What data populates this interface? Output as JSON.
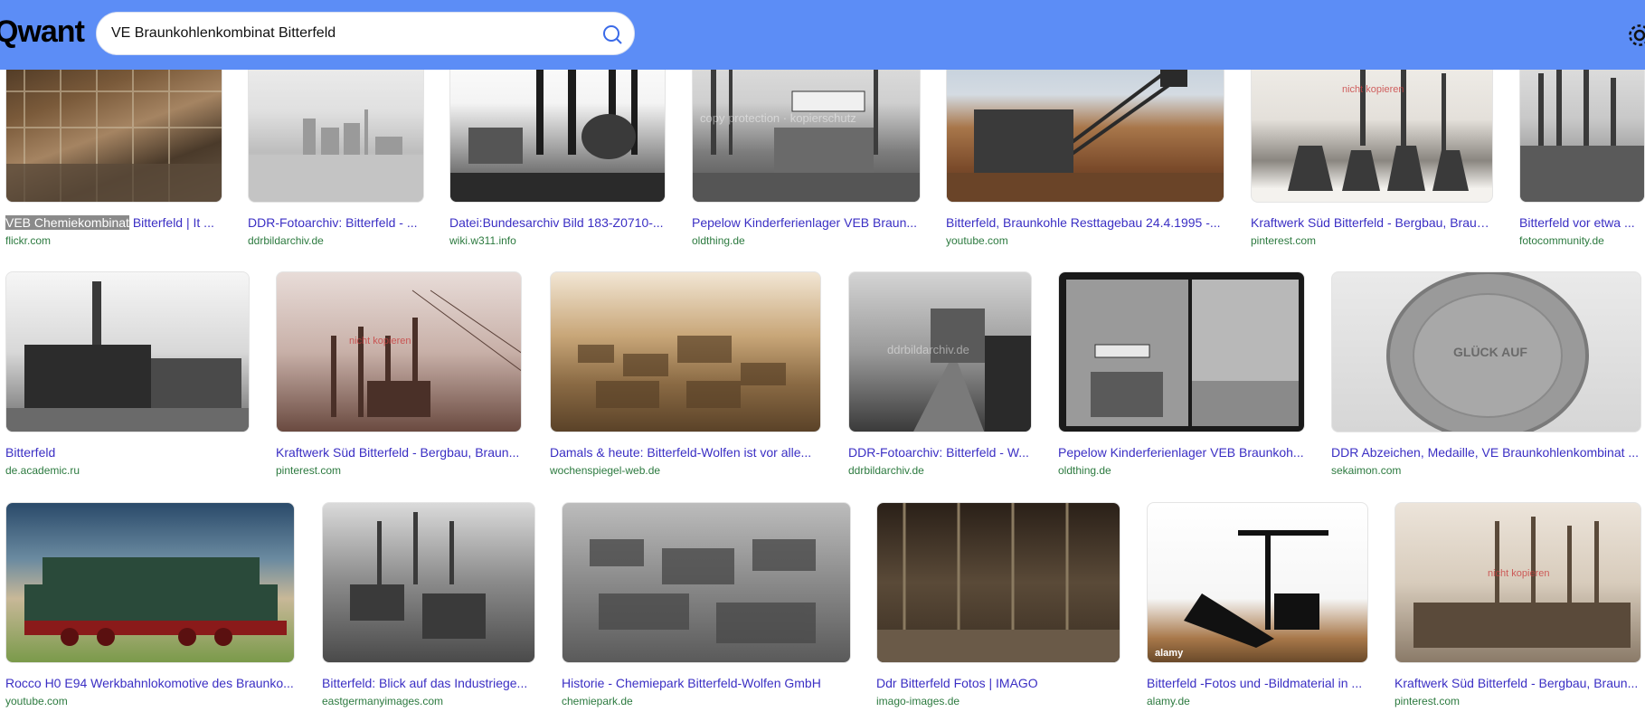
{
  "header": {
    "logo": "Qwant",
    "search_value": "VE Braunkohlenkombinat Bitterfeld",
    "search_icon": "search-icon",
    "settings_icon": "gear-icon",
    "accent": "#5c8df6"
  },
  "results": {
    "row1": [
      {
        "caption_highlight": "VEB Chemiekombinat",
        "caption": " Bitterfeld | It ...",
        "domain": "flickr.com"
      },
      {
        "caption": "DDR-Fotoarchiv: Bitterfeld - ...",
        "domain": "ddrbildarchiv.de"
      },
      {
        "caption": "Datei:Bundesarchiv Bild 183-Z0710-...",
        "domain": "wiki.w311.info"
      },
      {
        "caption": "Pepelow Kinderferienlager VEB Braun...",
        "domain": "oldthing.de",
        "watermark": "copy protection · kopierschutz"
      },
      {
        "caption": "Bitterfeld, Braunkohle Resttagebau 24.4.1995 -...",
        "domain": "youtube.com"
      },
      {
        "caption": "Kraftwerk Süd Bitterfeld - Bergbau, Braun...",
        "domain": "pinterest.com",
        "watermark": "nicht kopieren"
      },
      {
        "caption": "Bitterfeld vor etwa ...",
        "domain": "fotocommunity.de"
      }
    ],
    "row2": [
      {
        "caption": "Bitterfeld",
        "domain": "de.academic.ru"
      },
      {
        "caption": "Kraftwerk Süd Bitterfeld - Bergbau, Braun...",
        "domain": "pinterest.com",
        "watermark": "nicht kopieren"
      },
      {
        "caption": "Damals & heute: Bitterfeld-Wolfen ist vor alle...",
        "domain": "wochenspiegel-web.de"
      },
      {
        "caption": "DDR-Fotoarchiv: Bitterfeld - W...",
        "domain": "ddrbildarchiv.de",
        "watermark": "ddrbildarchiv.de"
      },
      {
        "caption": "Pepelow Kinderferienlager VEB Braunkoh...",
        "domain": "oldthing.de"
      },
      {
        "caption": "DDR Abzeichen, Medaille, VE Braunkohlenkombinat ...",
        "domain": "sekaimon.com",
        "coin_text": "GLÜCK AUF"
      }
    ],
    "row3": [
      {
        "caption": "Rocco H0 E94 Werkbahnlokomotive des Braunko...",
        "domain": "youtube.com"
      },
      {
        "caption": "Bitterfeld: Blick auf das Industriege...",
        "domain": "eastgermanyimages.com"
      },
      {
        "caption": "Historie - Chemiepark Bitterfeld-Wolfen GmbH",
        "domain": "chemiepark.de"
      },
      {
        "caption": "Ddr Bitterfeld Fotos | IMAGO",
        "domain": "imago-images.de"
      },
      {
        "caption": "Bitterfeld -Fotos und -Bildmaterial in ...",
        "domain": "alamy.de",
        "watermark": "alamy"
      },
      {
        "caption": "Kraftwerk Süd Bitterfeld - Bergbau, Braun...",
        "domain": "pinterest.com",
        "watermark": "nicht kopieren"
      }
    ]
  }
}
